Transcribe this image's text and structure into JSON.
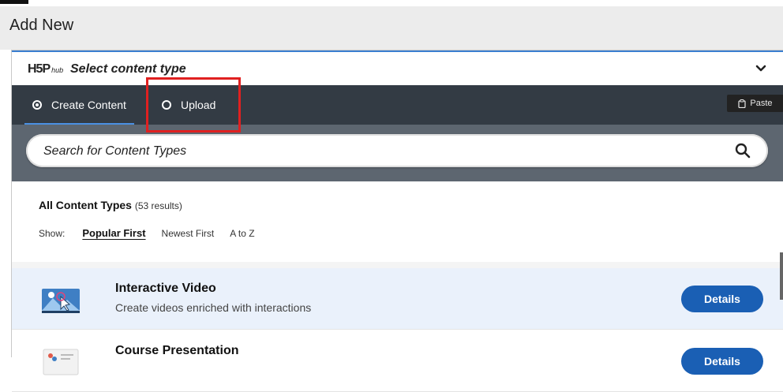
{
  "page": {
    "heading": "Add New"
  },
  "hub": {
    "logo": "H5P",
    "logo_suffix": "hub",
    "title": "Select content type",
    "tabs": [
      {
        "label": "Create Content",
        "selected": true
      },
      {
        "label": "Upload",
        "selected": false
      }
    ],
    "paste_label": "Paste",
    "search_placeholder": "Search for Content Types",
    "results_title": "All Content Types",
    "results_count": "(53 results)",
    "show_label": "Show:",
    "sort_options": [
      "Popular First",
      "Newest First",
      "A to Z"
    ],
    "sort_active": "Popular First",
    "items": [
      {
        "title": "Interactive Video",
        "description": "Create videos enriched with interactions",
        "button": "Details",
        "icon": "interactive-video-icon"
      },
      {
        "title": "Course Presentation",
        "description": "",
        "button": "Details",
        "icon": "course-presentation-icon"
      }
    ]
  },
  "colors": {
    "accent": "#1a5fb4",
    "tabs_bg": "#333b44",
    "search_strip": "#5d6670",
    "highlight": "#e02020",
    "row_selected": "#eaf1fb"
  }
}
